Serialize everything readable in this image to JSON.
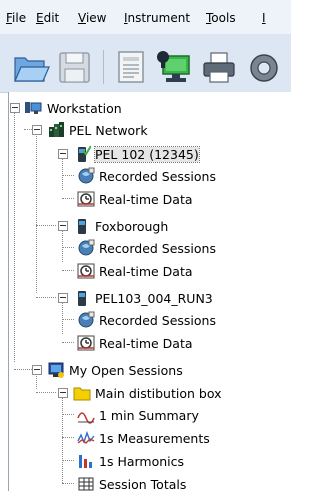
{
  "menu": {
    "file": {
      "u": "F",
      "rest": "ile"
    },
    "edit": {
      "u": "E",
      "rest": "dit"
    },
    "view": {
      "u": "V",
      "rest": "iew"
    },
    "instrument": {
      "u": "I",
      "rest": "nstrument"
    },
    "tools": {
      "u": "T",
      "rest": "ools"
    }
  },
  "toolbar": {
    "icons": [
      "open-folder-icon",
      "save-disk-icon",
      "report-icon",
      "connect-computer-icon",
      "print-icon",
      "settings-icon"
    ]
  },
  "tree": {
    "workstation": "Workstation",
    "network": "PEL Network",
    "instrument1": {
      "name": "PEL 102 (12345)",
      "recorded": "Recorded Sessions",
      "realtime": "Real-time Data"
    },
    "instrument2": {
      "name": "Foxborough",
      "recorded": "Recorded Sessions",
      "realtime": "Real-time Data"
    },
    "instrument3": {
      "name": "PEL103_004_RUN3",
      "recorded": "Recorded Sessions",
      "realtime": "Real-time Data"
    },
    "open_sessions": "My Open Sessions",
    "session": {
      "name": "Main distibution box",
      "items": [
        "1 min Summary",
        "1s Measurements",
        "1s Harmonics",
        "Session Totals"
      ]
    }
  },
  "colors": {
    "menubar": "#eef3fa",
    "toolbar": "#dde7f3",
    "selection": "#e6e6e6"
  }
}
